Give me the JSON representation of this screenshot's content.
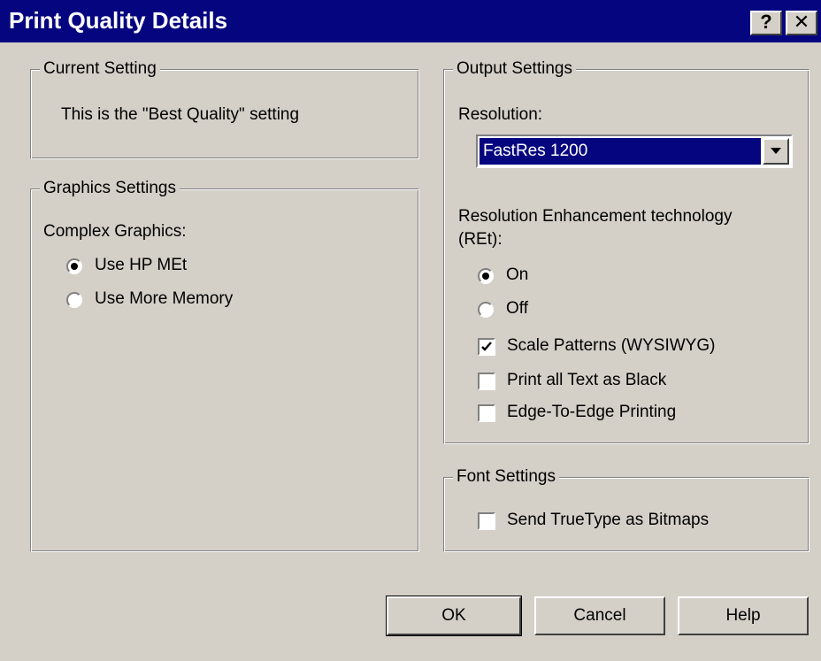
{
  "window": {
    "title": "Print Quality Details",
    "help_button": "?",
    "close_button": "✕"
  },
  "current_setting": {
    "legend": "Current Setting",
    "text": "This is the \"Best Quality\" setting"
  },
  "graphics_settings": {
    "legend": "Graphics Settings",
    "complex_label": "Complex Graphics:",
    "options": [
      {
        "label": "Use HP MEt",
        "selected": true
      },
      {
        "label": "Use More Memory",
        "selected": false
      }
    ]
  },
  "output_settings": {
    "legend": "Output Settings",
    "resolution_label": "Resolution:",
    "resolution_value": "FastRes 1200",
    "ret_label_line1": "Resolution Enhancement technology",
    "ret_label_line2": "(REt):",
    "ret_options": [
      {
        "label": "On",
        "selected": true
      },
      {
        "label": "Off",
        "selected": false
      }
    ],
    "checkboxes": [
      {
        "label": "Scale Patterns (WYSIWYG)",
        "checked": true
      },
      {
        "label": "Print all Text as Black",
        "checked": false
      },
      {
        "label": "Edge-To-Edge Printing",
        "checked": false
      }
    ]
  },
  "font_settings": {
    "legend": "Font Settings",
    "checkbox": {
      "label": "Send TrueType as Bitmaps",
      "checked": false
    }
  },
  "buttons": {
    "ok": "OK",
    "cancel": "Cancel",
    "help": "Help"
  },
  "colors": {
    "titlebar": "#050580",
    "face": "#d4d0c8",
    "selection": "#050580"
  }
}
